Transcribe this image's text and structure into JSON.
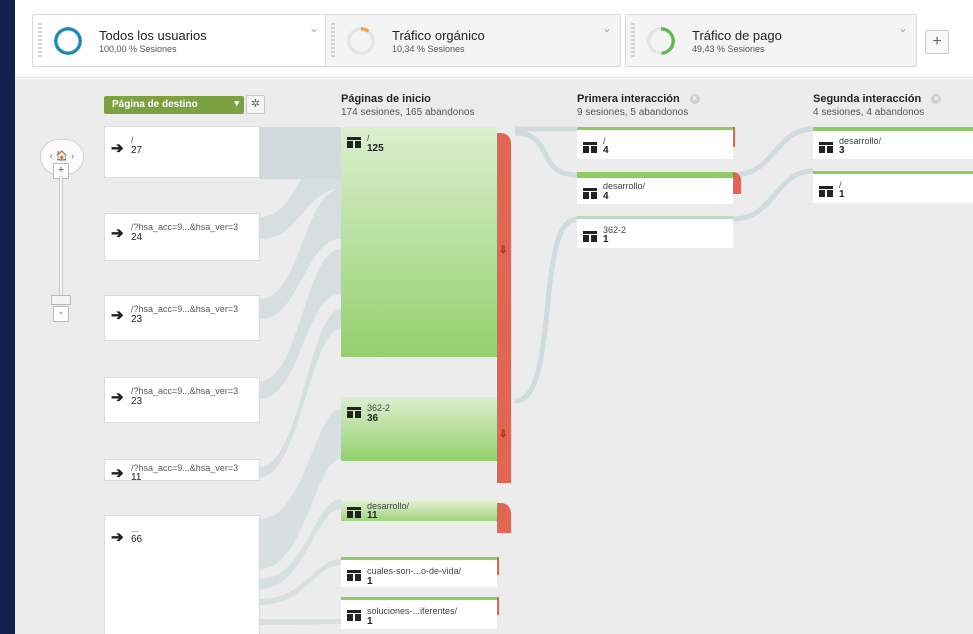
{
  "segments": [
    {
      "name": "Todos los usuarios",
      "sub": "100,00 % Sesiones",
      "ring_color": "#1a8ab8",
      "ring_fraction": 1.0
    },
    {
      "name": "Tráfico orgánico",
      "sub": "10,34 % Sesiones",
      "ring_color": "#f29e4c",
      "ring_fraction": 0.1034
    },
    {
      "name": "Tráfico de pago",
      "sub": "49,43 % Sesiones",
      "ring_color": "#5fba4d",
      "ring_fraction": 0.4943
    }
  ],
  "segment_add_label": "+",
  "segment_chevron": "⌄",
  "dimension_select": {
    "label": "Página de destino",
    "caret": "▾"
  },
  "gear_glyph": "✲",
  "columns": {
    "start": {
      "title": "Páginas de inicio",
      "sub": "174 sesiones, 165 abandonos"
    },
    "first": {
      "title": "Primera interacción",
      "sub": "9 sesiones, 5 abandonos"
    },
    "second": {
      "title": "Segunda interacción",
      "sub": "4 sesiones, 4 abandonos"
    }
  },
  "column_close": "×",
  "nav": {
    "home": "‹ 🏠 ›",
    "zoom_in": "+",
    "zoom_out": "-"
  },
  "sources": [
    {
      "label": "/",
      "value": "27"
    },
    {
      "label": "/?hsa_acc=9...&hsa_ver=3",
      "value": "24"
    },
    {
      "label": "/?hsa_acc=9...&hsa_ver=3",
      "value": "23"
    },
    {
      "label": "/?hsa_acc=9...&hsa_ver=3",
      "value": "23"
    },
    {
      "label": "/?hsa_acc=9...&hsa_ver=3",
      "value": "11"
    },
    {
      "label": "...",
      "value": "66"
    }
  ],
  "source_arrow": "➔",
  "start_pages": [
    {
      "label": "/",
      "value": "125"
    },
    {
      "label": "362-2",
      "value": "36"
    },
    {
      "label": "desarrollo/",
      "value": "11"
    },
    {
      "label": "cuales-son-...o-de-vida/",
      "value": "1"
    },
    {
      "label": "soluciones-...iferentes/",
      "value": "1"
    }
  ],
  "first_interaction": [
    {
      "label": "/",
      "value": "4"
    },
    {
      "label": "desarrollo/",
      "value": "4"
    },
    {
      "label": "362-2",
      "value": "1"
    }
  ],
  "second_interaction": [
    {
      "label": "desarrollo/",
      "value": "3"
    },
    {
      "label": "/",
      "value": "1"
    }
  ],
  "dropoff_glyph": "⇩",
  "colors": {
    "node_green": "#8ccc63",
    "dropoff_red": "#e06552",
    "link_gray": "#cdd8da",
    "accent_green": "#7ca13f"
  }
}
